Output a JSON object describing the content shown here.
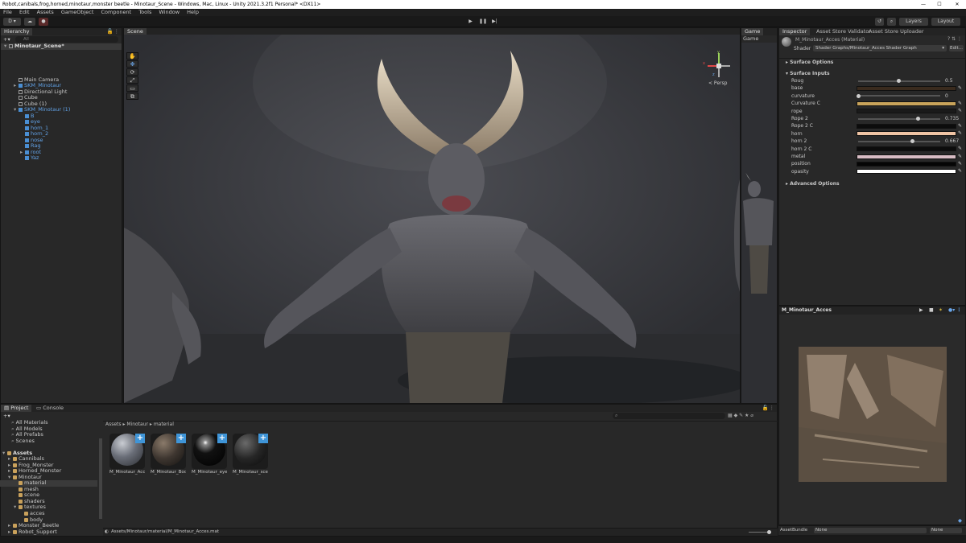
{
  "window": {
    "title": "Robot,canibals,frog,horned,minotaur,monster beetle - Minotaur_Scene - Windows, Mac, Linux - Unity 2021.3.2f1 Personal* <DX11>",
    "controls": [
      "—",
      "☐",
      "✕"
    ]
  },
  "menu": [
    "File",
    "Edit",
    "Assets",
    "GameObject",
    "Component",
    "Tools",
    "Window",
    "Help"
  ],
  "toolbar": {
    "account": "D ▾",
    "layers": "Layers",
    "layout": "Layout"
  },
  "hierarchy": {
    "tab": "Hierarchy",
    "search_placeholder": "All",
    "scene": "Minotaur_Scene*",
    "items": [
      {
        "label": "Main Camera",
        "depth": 1,
        "blue": false,
        "arrow": ""
      },
      {
        "label": "SKM_Minotaur",
        "depth": 1,
        "blue": true,
        "arrow": "▸"
      },
      {
        "label": "Directional Light",
        "depth": 1,
        "blue": false,
        "arrow": ""
      },
      {
        "label": "Cube",
        "depth": 1,
        "blue": false,
        "arrow": ""
      },
      {
        "label": "Cube (1)",
        "depth": 1,
        "blue": false,
        "arrow": ""
      },
      {
        "label": "SKM_Minotaur (1)",
        "depth": 1,
        "blue": true,
        "arrow": "▾"
      },
      {
        "label": "B",
        "depth": 2,
        "blue": true,
        "arrow": ""
      },
      {
        "label": "eye",
        "depth": 2,
        "blue": true,
        "arrow": ""
      },
      {
        "label": "horn_1",
        "depth": 2,
        "blue": true,
        "arrow": ""
      },
      {
        "label": "horn_2",
        "depth": 2,
        "blue": true,
        "arrow": ""
      },
      {
        "label": "nose",
        "depth": 2,
        "blue": true,
        "arrow": ""
      },
      {
        "label": "Rag",
        "depth": 2,
        "blue": true,
        "arrow": ""
      },
      {
        "label": "root",
        "depth": 2,
        "blue": true,
        "arrow": "▸"
      },
      {
        "label": "Yaz",
        "depth": 2,
        "blue": true,
        "arrow": ""
      }
    ]
  },
  "scene": {
    "tab": "Scene",
    "persp": "< Persp",
    "gizmo_x": "x",
    "gizmo_y": "y",
    "gizmo_z": "z"
  },
  "game": {
    "tab": "Game",
    "display": "Game"
  },
  "inspector": {
    "tabs": [
      "Inspector",
      "Asset Store Validator",
      "Asset Store Uploader"
    ],
    "material_name": "M_Minotaur_Acces (Material)",
    "shader_label": "Shader",
    "shader_value": "Shader Graphs/Minotaur_Acces Shader Graph",
    "edit_label": "Edit...",
    "surface_options": "Surface Options",
    "surface_inputs": "Surface Inputs",
    "advanced_options": "Advanced Options",
    "properties": [
      {
        "label": "Roug",
        "kind": "slider",
        "value": "0.5",
        "level": 0.5
      },
      {
        "label": "base",
        "kind": "color",
        "color": "#3a2b1e"
      },
      {
        "label": "curvature",
        "kind": "slider",
        "value": "0",
        "level": 0
      },
      {
        "label": "Curvature C",
        "kind": "color",
        "color": "#c8a35a"
      },
      {
        "label": "rope",
        "kind": "color",
        "color": "#1a1a1a"
      },
      {
        "label": "Rope 2",
        "kind": "slider",
        "value": "0.735",
        "level": 0.735
      },
      {
        "label": "Rope 2 C",
        "kind": "color",
        "color": "#0c0c0c"
      },
      {
        "label": "horn",
        "kind": "color",
        "color": "#f0c4a4"
      },
      {
        "label": "horn 2",
        "kind": "slider",
        "value": "0.667",
        "level": 0.667
      },
      {
        "label": "horn 2 C",
        "kind": "color",
        "color": "#0c0c0c"
      },
      {
        "label": "metal",
        "kind": "color",
        "color": "#d8bcc4"
      },
      {
        "label": "position",
        "kind": "color",
        "color": "#050505"
      },
      {
        "label": "opasity",
        "kind": "color",
        "color": "#ffffff"
      }
    ],
    "preview_title": "M_Minotaur_Acces",
    "assetbundle_label": "AssetBundle",
    "assetbundle_value": "None",
    "assetbundle_variant": "None"
  },
  "project": {
    "tabs": [
      "Project",
      "Console"
    ],
    "favorites": [
      "All Materials",
      "All Models",
      "All Prefabs",
      "Scenes"
    ],
    "tree": [
      {
        "label": "Assets",
        "depth": 0,
        "arrow": "▾",
        "selected": false
      },
      {
        "label": "Cannibals",
        "depth": 1,
        "arrow": "▸",
        "selected": false
      },
      {
        "label": "Frog_Monster",
        "depth": 1,
        "arrow": "▸",
        "selected": false
      },
      {
        "label": "Horned_Monster",
        "depth": 1,
        "arrow": "▸",
        "selected": false
      },
      {
        "label": "Minotaur",
        "depth": 1,
        "arrow": "▾",
        "selected": false
      },
      {
        "label": "material",
        "depth": 2,
        "arrow": "",
        "selected": true
      },
      {
        "label": "mesh",
        "depth": 2,
        "arrow": "",
        "selected": false
      },
      {
        "label": "scene",
        "depth": 2,
        "arrow": "",
        "selected": false
      },
      {
        "label": "shaders",
        "depth": 2,
        "arrow": "",
        "selected": false
      },
      {
        "label": "textures",
        "depth": 2,
        "arrow": "▾",
        "selected": false
      },
      {
        "label": "acces",
        "depth": 3,
        "arrow": "",
        "selected": false
      },
      {
        "label": "body",
        "depth": 3,
        "arrow": "",
        "selected": false
      },
      {
        "label": "Monster_Beetle",
        "depth": 1,
        "arrow": "▸",
        "selected": false
      },
      {
        "label": "Robot_Support",
        "depth": 1,
        "arrow": "▸",
        "selected": false
      }
    ],
    "breadcrumb": [
      "Assets",
      "Minotaur",
      "material"
    ],
    "assets": [
      {
        "label": "M_Minotaur_Acc...",
        "style": "acces"
      },
      {
        "label": "M_Minotaur_Body",
        "style": "body"
      },
      {
        "label": "M_Minotaur_eye",
        "style": "eye"
      },
      {
        "label": "M_Minotaur_sce...",
        "style": "dark"
      }
    ],
    "footer_path": "Assets/Minotaur/material/M_Minotaur_Acces.mat"
  }
}
